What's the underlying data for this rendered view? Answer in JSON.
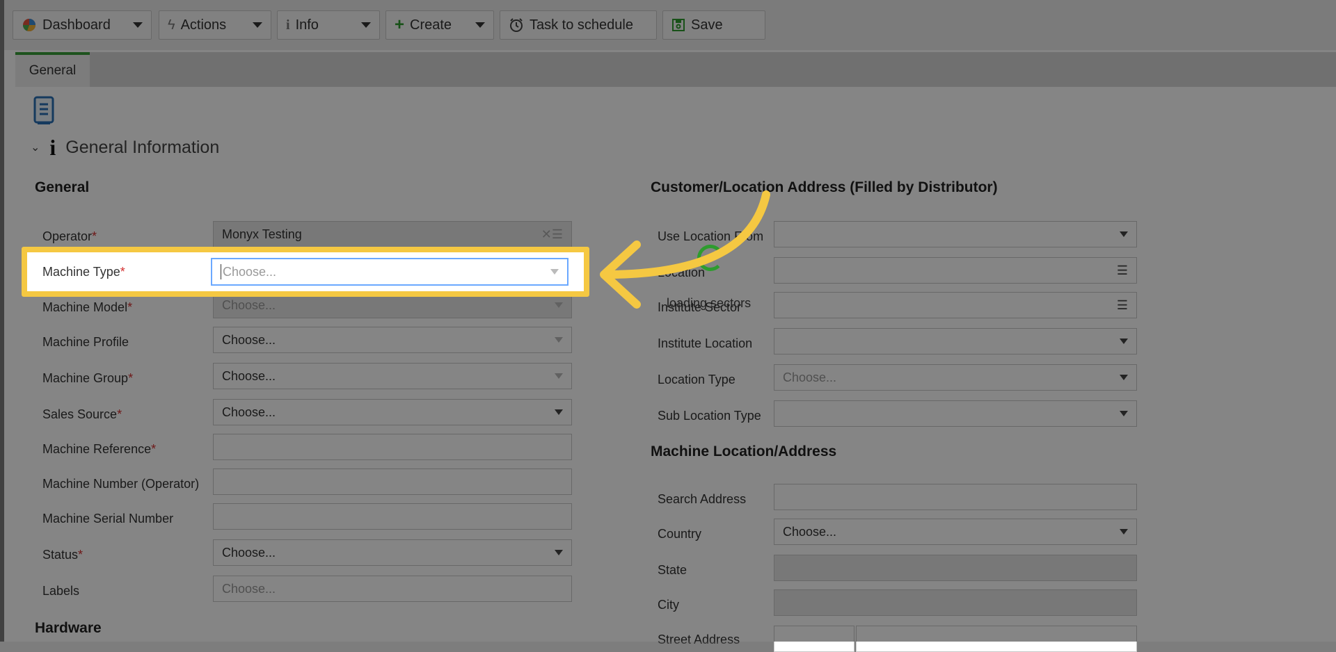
{
  "toolbar": {
    "dashboard": "Dashboard",
    "actions": "Actions",
    "info": "Info",
    "create": "Create",
    "task": "Task to schedule",
    "save": "Save"
  },
  "tabs": {
    "general": "General"
  },
  "section": {
    "title": "General Information"
  },
  "left": {
    "group_title": "General",
    "operator": {
      "label": "Operator",
      "value": "Monyx Testing"
    },
    "machine_type": {
      "label": "Machine Type",
      "placeholder": "Choose..."
    },
    "machine_model": {
      "label": "Machine Model",
      "placeholder": "Choose..."
    },
    "machine_profile": {
      "label": "Machine Profile",
      "value": "Choose..."
    },
    "machine_group": {
      "label": "Machine Group",
      "value": "Choose..."
    },
    "sales_source": {
      "label": "Sales Source",
      "value": "Choose..."
    },
    "machine_reference": {
      "label": "Machine Reference"
    },
    "machine_number": {
      "label": "Machine Number (Operator)"
    },
    "machine_serial": {
      "label": "Machine Serial Number"
    },
    "status": {
      "label": "Status",
      "value": "Choose..."
    },
    "labels": {
      "label": "Labels",
      "placeholder": "Choose..."
    },
    "hardware_title": "Hardware"
  },
  "right": {
    "customer_title": "Customer/Location Address (Filled by Distributor)",
    "use_location_from": "Use Location From",
    "location": "Location",
    "institute_sector": "Institute Sector",
    "loading": "loading sectors",
    "institute_location": "Institute Location",
    "location_type": {
      "label": "Location Type",
      "value": "Choose..."
    },
    "sub_location_type": "Sub Location Type",
    "machine_location_title": "Machine Location/Address",
    "search_address": "Search Address",
    "country": {
      "label": "Country",
      "value": "Choose..."
    },
    "state": "State",
    "city": "City",
    "street_address": "Street Address"
  },
  "colors": {
    "highlight": "#f5c842",
    "accent": "#2e9c2e",
    "required": "#d32f2f"
  }
}
